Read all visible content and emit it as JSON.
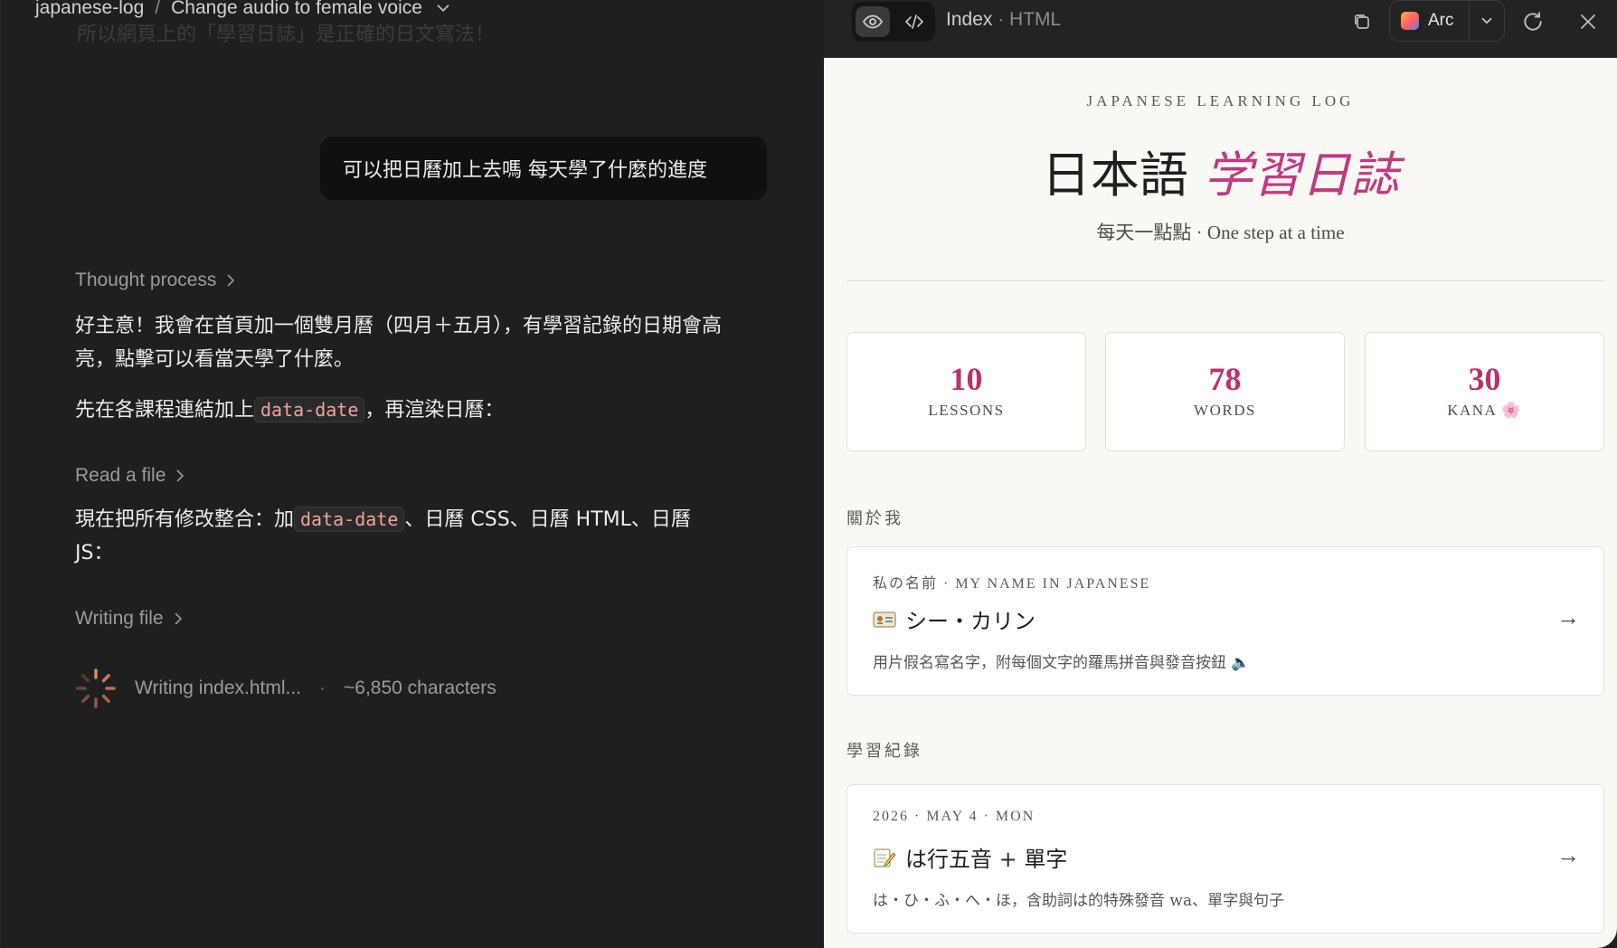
{
  "chat": {
    "breadcrumb": {
      "project": "japanese-log",
      "separator": "/",
      "task": "Change audio to female voice"
    },
    "ghost_line": "所以網頁上的「學習日誌」是正確的日文寫法！",
    "user_message": "可以把日曆加上去嗎 每天學了什麼的進度",
    "thought_label": "Thought process",
    "reply1": "好主意！我會在首頁加一個雙月曆（四月＋五月），有學習記錄的日期會高亮，點擊可以看當天學了什麼。",
    "reply2": {
      "before": "先在各課程連結加上",
      "code": "data-date",
      "after": "，再渲染日曆："
    },
    "read_label": "Read a file",
    "reply3": {
      "before": "現在把所有修改整合：加",
      "code": "data-date",
      "after": "、日曆 CSS、日曆 HTML、日曆 JS："
    },
    "writing_label": "Writing file",
    "status": {
      "file": "Writing index.html...",
      "separator": "·",
      "chars": "~6,850 characters"
    }
  },
  "preview": {
    "toolbar": {
      "title": "Index",
      "title_sep": " · ",
      "title_ext": "HTML",
      "browser": "Arc"
    },
    "page": {
      "eyebrow": "JAPANESE LEARNING LOG",
      "title_main": "日本語",
      "title_accent": "学習日誌",
      "tagline": "每天一點點 · One step at a time",
      "stats": [
        {
          "value": "10",
          "label": "LESSONS"
        },
        {
          "value": "78",
          "label": "WORDS"
        },
        {
          "value": "30",
          "label": "KANA 🌸"
        }
      ],
      "about_heading": "關於我",
      "about_card": {
        "meta": "私の名前 · MY NAME IN JAPANESE",
        "icon": "id-card-icon",
        "title": "シー・カリン",
        "desc": "用片假名寫名字，附每個文字的羅馬拼音與發音按鈕 🔈",
        "arrow": "→"
      },
      "log_heading": "學習紀錄",
      "log_card": {
        "meta": "2026 · MAY 4 · MON",
        "icon": "memo-icon",
        "title": "は行五音 + 單字",
        "desc": "は・ひ・ふ・へ・ほ，含助詞は的特殊發音 wa、單字與句子",
        "arrow": "→"
      }
    }
  },
  "colors": {
    "accent": "#c03a80",
    "chat_bg": "#1f1f1f",
    "page_bg": "#faf8f3"
  }
}
